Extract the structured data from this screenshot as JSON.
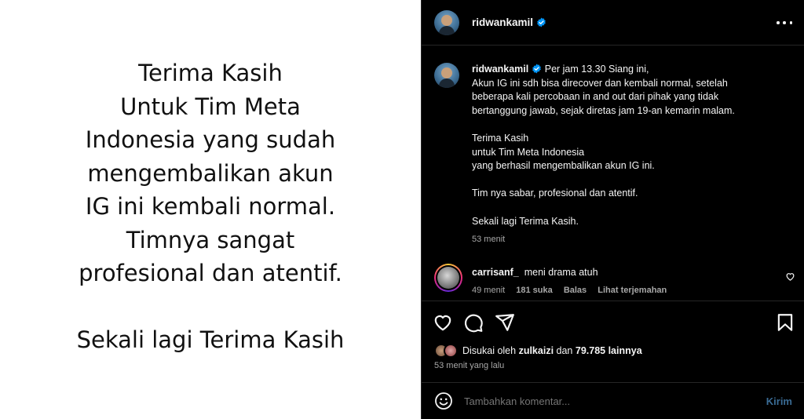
{
  "image_text": {
    "lines": [
      "Terima Kasih",
      "Untuk Tim Meta",
      "Indonesia yang sudah",
      "mengembalikan akun",
      "IG ini kembali normal.",
      "Timnya sangat",
      "profesional dan atentif."
    ],
    "closing": "Sekali lagi Terima Kasih"
  },
  "header": {
    "username": "ridwankamil",
    "more_icon": "more-horizontal-icon"
  },
  "caption": {
    "username": "ridwankamil",
    "lead": "Per jam 13.30 Siang ini,",
    "lines": [
      "Akun IG ini sdh bisa direcover dan kembali normal, setelah",
      "beberapa kali percobaan in and out dari pihak yang tidak",
      "bertanggung jawab, sejak diretas jam 19-an kemarin malam.",
      "",
      "Terima Kasih",
      "untuk Tim Meta Indonesia",
      "yang berhasil mengembalikan akun IG ini.",
      "",
      "Tim nya sabar, profesional dan atentif.",
      "",
      "Sekali lagi Terima Kasih."
    ],
    "time": "53 menit"
  },
  "comment": {
    "username": "carrisanf_",
    "text": "meni drama atuh",
    "time": "49 menit",
    "likes": "181 suka",
    "reply": "Balas",
    "translate": "Lihat terjemahan"
  },
  "likes": {
    "prefix": "Disukai oleh",
    "user": "zulkaizi",
    "middle": "dan",
    "others": "79.785 lainnya"
  },
  "posted": "53 menit yang lalu",
  "add_comment": {
    "placeholder": "Tambahkan komentar...",
    "post_label": "Kirim"
  },
  "colors": {
    "background": "#000000",
    "verified": "#0095f6",
    "post_button": "#3a6c95",
    "muted_text": "#a8a8a8"
  }
}
